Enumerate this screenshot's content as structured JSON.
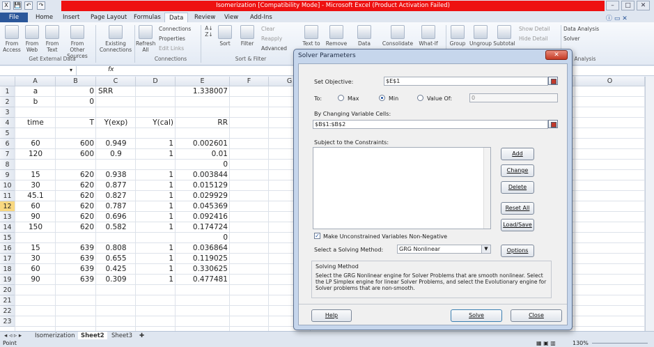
{
  "app": {
    "title": "Isomerization  [Compatibility Mode]  -  Microsoft Excel (Product Activation Failed)",
    "qat": [
      "💾",
      "↶",
      "↷"
    ]
  },
  "tabs": [
    "File",
    "Home",
    "Insert",
    "Page Layout",
    "Formulas",
    "Data",
    "Review",
    "View",
    "Add-Ins"
  ],
  "active_tab": "Data",
  "ribbon": {
    "get_external": {
      "buttons": [
        "From Access",
        "From Web",
        "From Text",
        "From Other Sources"
      ],
      "group": "Get External Data"
    },
    "existing": "Existing Connections",
    "connections": {
      "refresh": "Refresh All",
      "items": [
        "Connections",
        "Properties",
        "Edit Links"
      ],
      "group": "Connections"
    },
    "sort": {
      "sort": "Sort",
      "filter": "Filter",
      "items": [
        "Clear",
        "Reapply",
        "Advanced"
      ],
      "group": "Sort & Filter"
    },
    "tools": [
      "Text to",
      "Remove",
      "Data",
      "Consolidate",
      "What-If"
    ],
    "outline": {
      "buttons": [
        "Group",
        "Ungroup",
        "Subtotal"
      ],
      "items": [
        "Show Detail",
        "Hide Detail"
      ]
    },
    "analysis": {
      "items": [
        "Data Analysis",
        "Solver"
      ],
      "group": "Analysis"
    }
  },
  "formula": {
    "namebox": "",
    "fx": "fx"
  },
  "grid": {
    "columns": [
      "A",
      "B",
      "C",
      "D",
      "E",
      "F",
      "G",
      "O"
    ],
    "rows": [
      "1",
      "2",
      "3",
      "4",
      "5",
      "6",
      "7",
      "8",
      "9",
      "10",
      "11",
      "12",
      "13",
      "14",
      "15",
      "16",
      "17",
      "18",
      "19",
      "20",
      "21",
      "22",
      "23"
    ],
    "cells": [
      [
        "a",
        "0",
        "SRR",
        "",
        "1.338007"
      ],
      [
        "b",
        "0",
        "",
        "",
        ""
      ],
      [
        "",
        "",
        "",
        "",
        ""
      ],
      [
        "time",
        "T",
        "Y(exp)",
        "Y(cal)",
        "RR"
      ],
      [
        "",
        "",
        "",
        "",
        ""
      ],
      [
        "60",
        "600",
        "0.949",
        "1",
        "0.002601"
      ],
      [
        "120",
        "600",
        "0.9",
        "1",
        "0.01"
      ],
      [
        "",
        "",
        "",
        "",
        "0"
      ],
      [
        "15",
        "620",
        "0.938",
        "1",
        "0.003844"
      ],
      [
        "30",
        "620",
        "0.877",
        "1",
        "0.015129"
      ],
      [
        "45.1",
        "620",
        "0.827",
        "1",
        "0.029929"
      ],
      [
        "60",
        "620",
        "0.787",
        "1",
        "0.045369"
      ],
      [
        "90",
        "620",
        "0.696",
        "1",
        "0.092416"
      ],
      [
        "150",
        "620",
        "0.582",
        "1",
        "0.174724"
      ],
      [
        "",
        "",
        "",
        "",
        "0"
      ],
      [
        "15",
        "639",
        "0.808",
        "1",
        "0.036864"
      ],
      [
        "30",
        "639",
        "0.655",
        "1",
        "0.119025"
      ],
      [
        "60",
        "639",
        "0.425",
        "1",
        "0.330625"
      ],
      [
        "90",
        "639",
        "0.309",
        "1",
        "0.477481"
      ],
      [
        "",
        "",
        "",
        "",
        ""
      ],
      [
        "",
        "",
        "",
        "",
        ""
      ],
      [
        "",
        "",
        "",
        "",
        ""
      ],
      [
        "",
        "",
        "",
        "",
        ""
      ]
    ]
  },
  "sheets": [
    "Isomerization",
    "Sheet2",
    "Sheet3"
  ],
  "active_sheet": "Sheet2",
  "status": {
    "mode": "Point",
    "zoom": "130%"
  },
  "dialog": {
    "title": "Solver Parameters",
    "close": "✕",
    "set_objective_label": "Set Objective:",
    "objective": "$E$1",
    "to_label": "To:",
    "radios": [
      "Max",
      "Min",
      "Value Of:"
    ],
    "value_of": "0",
    "changing_label": "By Changing Variable Cells:",
    "changing": "$B$1:$B$2",
    "constraints_label": "Subject to the Constraints:",
    "side_buttons": [
      "Add",
      "Change",
      "Delete",
      "Reset All",
      "Load/Save"
    ],
    "nonneg": "Make Unconstrained Variables Non-Negative",
    "method_label": "Select a Solving Method:",
    "method": "GRG Nonlinear",
    "options": "Options",
    "solving_title": "Solving Method",
    "solving_text": "Select the GRG Nonlinear engine for Solver Problems that are smooth nonlinear. Select the LP Simplex engine for linear Solver Problems, and select the Evolutionary engine for Solver problems that are non-smooth.",
    "help": "Help",
    "solve": "Solve",
    "close_btn": "Close"
  }
}
